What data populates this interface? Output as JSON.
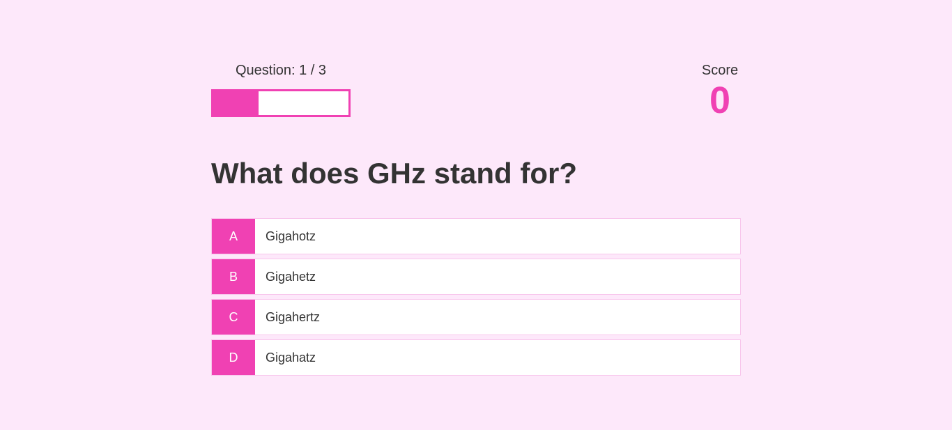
{
  "hud": {
    "progress_text": "Question: 1 / 3",
    "progress_fraction": 0.333,
    "score_label": "Score",
    "score_value": "0"
  },
  "question": {
    "text": "What does GHz stand for?"
  },
  "choices": [
    {
      "prefix": "A",
      "text": "Gigahotz"
    },
    {
      "prefix": "B",
      "text": "Gigahetz"
    },
    {
      "prefix": "C",
      "text": "Gigahertz"
    },
    {
      "prefix": "D",
      "text": "Gigahatz"
    }
  ],
  "colors": {
    "accent": "#f041b3",
    "background": "#fde8fa",
    "text": "#333333"
  }
}
